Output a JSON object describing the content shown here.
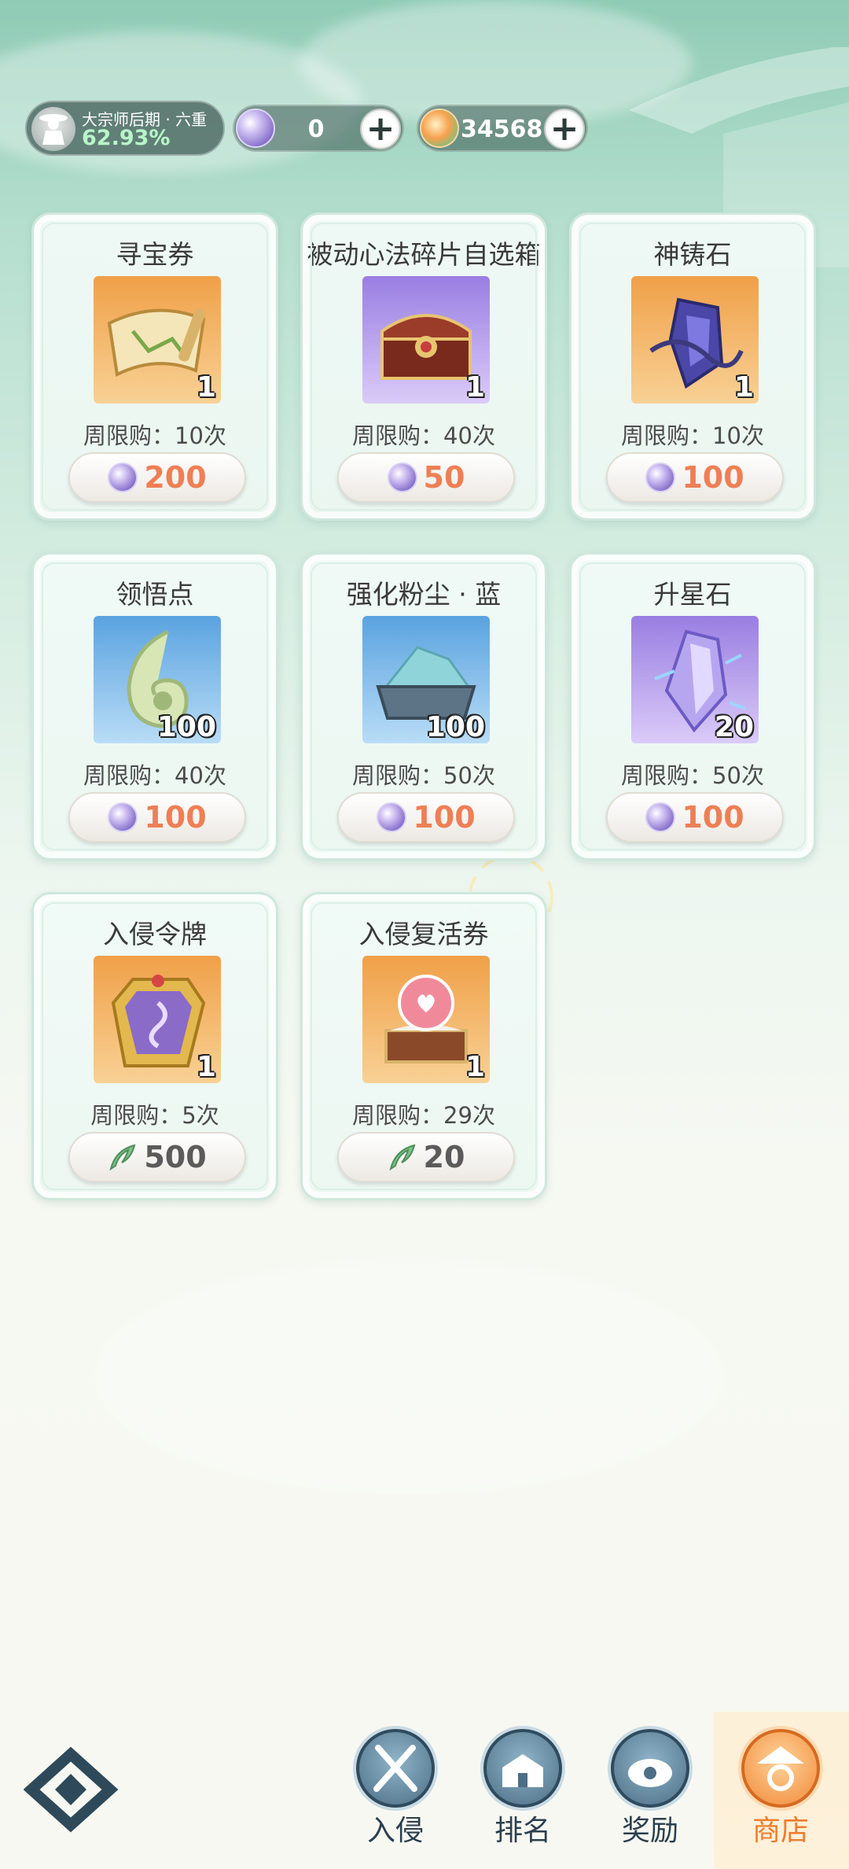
{
  "header": {
    "rank_title": "大宗师后期 · 六重",
    "rank_percent": "62.93%",
    "currency_orb": "0",
    "currency_jade": "34568"
  },
  "shop": {
    "items": [
      {
        "name": "寻宝券",
        "count": "1",
        "limit": "周限购：10次",
        "price": "200",
        "currency": "orb",
        "color": "orange",
        "icon": "treasure-map-icon"
      },
      {
        "name": "被动心法碎片自选箱",
        "count": "1",
        "limit": "周限购：40次",
        "price": "50",
        "currency": "orb",
        "color": "purple",
        "icon": "treasure-chest-icon"
      },
      {
        "name": "神铸石",
        "count": "1",
        "limit": "周限购：10次",
        "price": "100",
        "currency": "orb",
        "color": "orange",
        "icon": "forge-crystal-icon"
      },
      {
        "name": "领悟点",
        "count": "100",
        "limit": "周限购：40次",
        "price": "100",
        "currency": "orb",
        "color": "blue",
        "icon": "jade-pendant-icon"
      },
      {
        "name": "强化粉尘 · 蓝",
        "count": "100",
        "limit": "周限购：50次",
        "price": "100",
        "currency": "orb",
        "color": "blue",
        "icon": "dust-box-icon"
      },
      {
        "name": "升星石",
        "count": "20",
        "limit": "周限购：50次",
        "price": "100",
        "currency": "orb",
        "color": "purple",
        "icon": "star-crystal-icon"
      },
      {
        "name": "入侵令牌",
        "count": "1",
        "limit": "周限购：5次",
        "price": "500",
        "currency": "leaf",
        "color": "orange",
        "icon": "invasion-token-icon"
      },
      {
        "name": "入侵复活券",
        "count": "1",
        "limit": "周限购：29次",
        "price": "20",
        "currency": "leaf",
        "color": "orange",
        "icon": "revive-orb-icon"
      }
    ]
  },
  "nav": {
    "invade": "入侵",
    "rank": "排名",
    "reward": "奖励",
    "shop": "商店"
  }
}
